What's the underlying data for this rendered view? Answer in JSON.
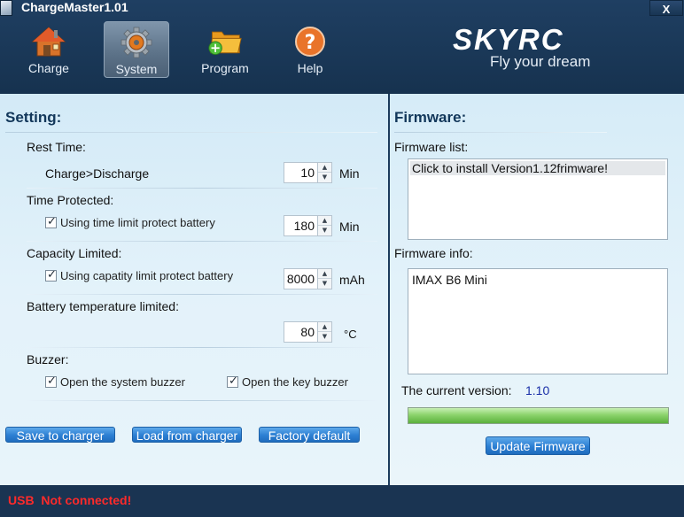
{
  "window": {
    "title": "ChargeMaster1.01",
    "close_label": "X"
  },
  "nav": [
    {
      "label": "Charge",
      "icon": "house-icon"
    },
    {
      "label": "System",
      "icon": "gear-icon",
      "active": true
    },
    {
      "label": "Program",
      "icon": "folder-add-icon"
    },
    {
      "label": "Help",
      "icon": "help-icon"
    }
  ],
  "brand": {
    "logo": "SKYRC",
    "tagline": "Fly your dream"
  },
  "setting": {
    "heading": "Setting:",
    "rest_time": {
      "label": "Rest Time:",
      "sub_label": "Charge>Discharge",
      "value": "10",
      "unit": "Min"
    },
    "time_protected": {
      "label": "Time Protected:",
      "checkbox_label": "Using time limit protect battery",
      "checked": true,
      "value": "180",
      "unit": "Min"
    },
    "capacity_limited": {
      "label": "Capacity Limited:",
      "checkbox_label": "Using capatity limit protect battery",
      "checked": true,
      "value": "8000",
      "unit": "mAh"
    },
    "temperature": {
      "label": "Battery temperature limited:",
      "value": "80",
      "unit": "°C"
    },
    "buzzer": {
      "label": "Buzzer:",
      "system_buzzer_label": "Open the system buzzer",
      "system_buzzer_checked": true,
      "key_buzzer_label": "Open the key buzzer",
      "key_buzzer_checked": true
    },
    "buttons": {
      "save": "Save to charger",
      "load": "Load from charger",
      "factory": "Factory default"
    }
  },
  "firmware": {
    "heading": "Firmware:",
    "list_label": "Firmware list:",
    "list_items": [
      "Click to install Version1.12frimware!"
    ],
    "info_label": "Firmware info:",
    "info_text": "IMAX B6 Mini",
    "current_version_label": "The current version:",
    "current_version": "1.10",
    "progress_fraction": 1.0,
    "update_button": "Update Firmware",
    "version_color": "#1a2fa8"
  },
  "status": {
    "text": "USB  Not connected!",
    "color": "#ff2a2a"
  }
}
